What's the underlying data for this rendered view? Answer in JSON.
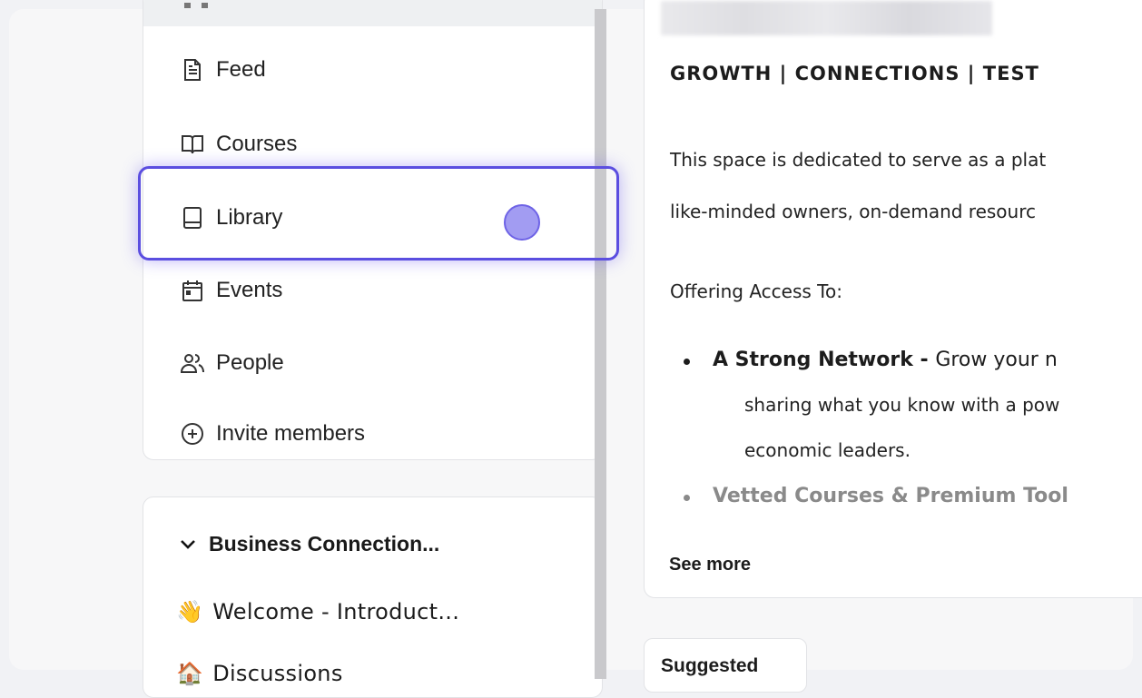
{
  "nav": {
    "items": [
      {
        "label": "Feed",
        "icon": "document-icon"
      },
      {
        "label": "Courses",
        "icon": "open-book-icon"
      },
      {
        "label": "Library",
        "icon": "closed-book-icon"
      },
      {
        "label": "Events",
        "icon": "calendar-icon"
      },
      {
        "label": "People",
        "icon": "people-icon"
      },
      {
        "label": "Invite members",
        "icon": "plus-circle-icon"
      }
    ],
    "highlighted": "Library"
  },
  "spaces": {
    "group_label": "Business Connection...",
    "items": [
      {
        "emoji": "👋",
        "label": "Welcome - Introduct..."
      },
      {
        "emoji": "🏠",
        "label": "Discussions"
      }
    ]
  },
  "about": {
    "headline": "GROWTH  |  CONNECTIONS  |  TEST",
    "intro_line1": "This space is dedicated to serve as a plat",
    "intro_line2": "like-minded owners, on-demand resourc",
    "offering": "Offering Access To:",
    "bullet1_bold": "A Strong Network - ",
    "bullet1_text": "Grow your n",
    "bullet1_cont1": "sharing what you know with a pow",
    "bullet1_cont2": "economic leaders.",
    "bullet2_bold": "Vetted Courses & Premium Tool",
    "see_more": "See more"
  },
  "suggested": "Suggested",
  "colors": {
    "highlight": "#5b4ee0",
    "click_dot": "#a29cf2"
  }
}
